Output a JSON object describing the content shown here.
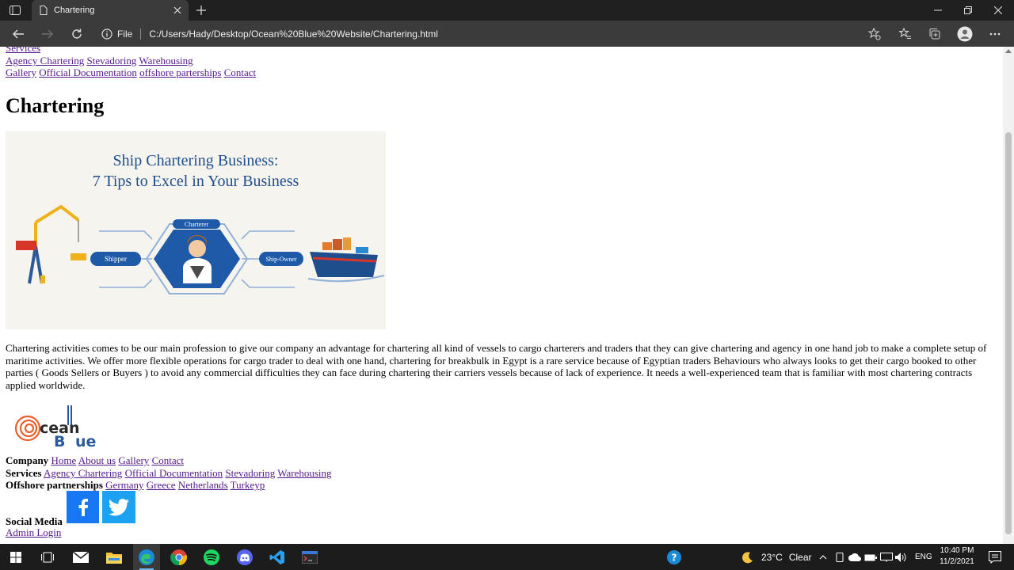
{
  "browser": {
    "tab_title": "Chartering",
    "file_label": "File",
    "url": "C:/Users/Hady/Desktop/Ocean%20Blue%20Website/Chartering.html"
  },
  "page": {
    "nav": {
      "line0": [
        "Services"
      ],
      "line1": [
        "Agency Chartering",
        "Stevadoring",
        "Warehousing"
      ],
      "line2": [
        "Gallery",
        "Official Documentation",
        "offshore parterships",
        "Contact"
      ]
    },
    "title": "Chartering",
    "hero": {
      "headline1": "Ship Chartering Business:",
      "headline2": "7 Tips to Excel in Your Business",
      "charterer": "Charterer",
      "shipper": "Shipper",
      "ship_owner": "Ship-Owner"
    },
    "body": "Chartering activities comes to be our main profession to give our company an advantage for chartering all kind of vessels to cargo charterers and traders that they can give chartering and agency in one hand job to make a complete setup of maritime activities. We offer more flexible operations for cargo trader to deal with one hand, chartering for breakbulk in Egypt is a rare service because of Egyptian traders Behaviours who always looks to get their cargo booked to other parties ( Goods Sellers or Buyers ) to avoid any commercial difficulties they can face during chartering their carriers vessels because of lack of experience. It needs a well-experienced team that is familiar with most chartering contracts applied worldwide.",
    "footer": {
      "logo_word1": "cean",
      "logo_word2": "B",
      "logo_word3": "ue",
      "company_label": "Company",
      "company_links": [
        "Home",
        "About us",
        "Gallery",
        "Contact"
      ],
      "services_label": "Services",
      "services_links": [
        "Agency Chartering",
        "Official Documentation",
        "Stevadoring",
        "Warehousing"
      ],
      "offshore_label": "Offshore partnerships",
      "offshore_links": [
        "Germany",
        "Greece",
        "Netherlands",
        "Turkeyp"
      ],
      "social_label": "Social Media",
      "admin_login": "Admin Login"
    }
  },
  "taskbar": {
    "weather_temp": "23°C",
    "weather_desc": "Clear",
    "language": "ENG",
    "time": "10:40 PM",
    "date": "11/2/2021"
  },
  "colors": {
    "link_visited": "#551a8b",
    "hero_navy": "#1e4e8c",
    "facebook": "#1877f2",
    "twitter": "#1da1f2",
    "logo_orange": "#e8602c"
  }
}
